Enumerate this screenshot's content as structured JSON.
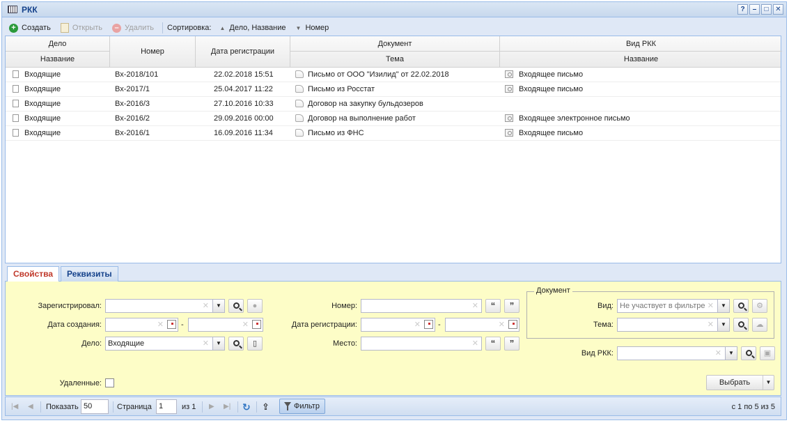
{
  "window": {
    "title": "РКК",
    "buttons": [
      "?",
      "–",
      "□",
      "✕"
    ]
  },
  "toolbar": {
    "create": "Создать",
    "open": "Открыть",
    "delete": "Удалить",
    "sort_label": "Сортировка:",
    "sort1": "Дело, Название",
    "sort2": "Номер"
  },
  "grid": {
    "headers": {
      "delo": "Дело",
      "delo_name": "Название",
      "number": "Номер",
      "reg_date": "Дата регистрации",
      "document": "Документ",
      "doc_subject": "Тема",
      "rkk_kind": "Вид РКК",
      "rkk_name": "Название"
    },
    "rows": [
      {
        "delo": "Входящие",
        "number": "Вх-2018/101",
        "date": "22.02.2018 15:51",
        "subject": "Письмо от ООО \"Изилид\" от 22.02.2018",
        "kind": "Входящее письмо"
      },
      {
        "delo": "Входящие",
        "number": "Вх-2017/1",
        "date": "25.04.2017 11:22",
        "subject": "Письмо из Росстат",
        "kind": "Входящее письмо"
      },
      {
        "delo": "Входящие",
        "number": "Вх-2016/3",
        "date": "27.10.2016 10:33",
        "subject": "Договор на закупку бульдозеров",
        "kind": ""
      },
      {
        "delo": "Входящие",
        "number": "Вх-2016/2",
        "date": "29.09.2016 00:00",
        "subject": "Договор на выполнение работ",
        "kind": "Входящее электронное письмо"
      },
      {
        "delo": "Входящие",
        "number": "Вх-2016/1",
        "date": "16.09.2016 11:34",
        "subject": "Письмо из ФНС",
        "kind": "Входящее письмо"
      }
    ]
  },
  "tabs": {
    "properties": "Свойства",
    "requisites": "Реквизиты"
  },
  "form": {
    "registered_by": "Зарегистрировал:",
    "created_date": "Дата создания:",
    "delo": "Дело:",
    "delo_value": "Входящие",
    "number": "Номер:",
    "reg_date": "Дата регистрации:",
    "place": "Место:",
    "document_group": "Документ",
    "kind": "Вид:",
    "kind_value": "Не участвует в фильтре",
    "subject": "Тема:",
    "rkk_kind": "Вид РКК:",
    "deleted": "Удаленные:",
    "dash": "-",
    "select_button": "Выбрать"
  },
  "pager": {
    "show": "Показать",
    "page_size": "50",
    "page": "Страница",
    "page_value": "1",
    "of": "из 1",
    "filter": "Фильтр",
    "range": "с 1 по 5 из 5"
  }
}
